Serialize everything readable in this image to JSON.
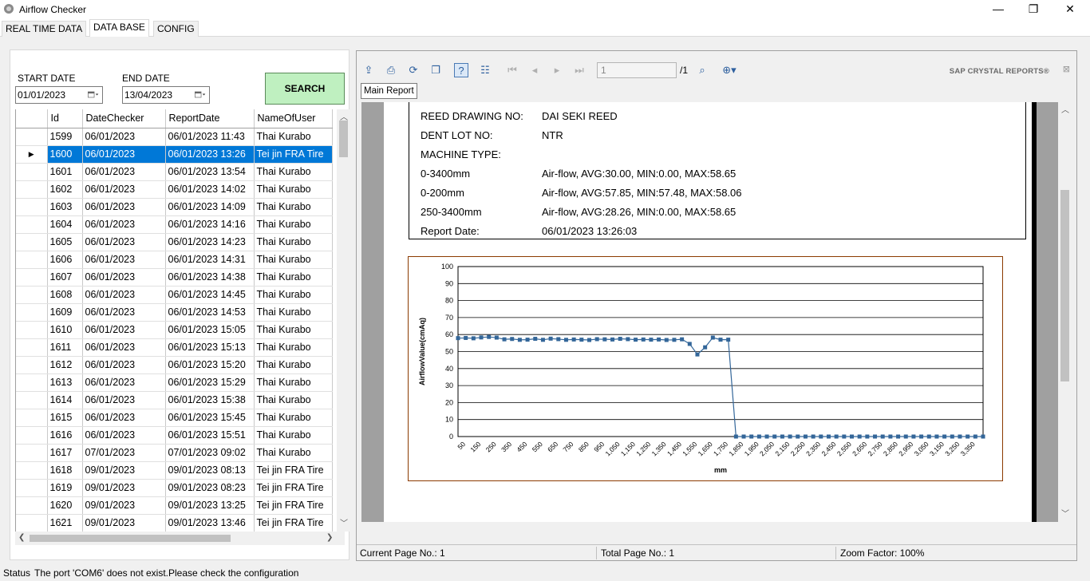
{
  "window": {
    "title": "Airflow Checker",
    "min": "—",
    "max": "❐",
    "close": "✕"
  },
  "tabs": [
    "REAL TIME DATA",
    "DATA BASE",
    "CONFIG"
  ],
  "filter": {
    "start_label": "START DATE",
    "start_value": "01/01/2023",
    "end_label": "END DATE",
    "end_value": "13/04/2023",
    "search_label": "SEARCH"
  },
  "grid": {
    "columns": [
      "Id",
      "DateChecker",
      "ReportDate",
      "NameOfUser"
    ],
    "selected_index": 1,
    "rows": [
      [
        "1599",
        "06/01/2023",
        "06/01/2023 11:43",
        "Thai Kurabo"
      ],
      [
        "1600",
        "06/01/2023",
        "06/01/2023 13:26",
        "Tei jin FRA Tire"
      ],
      [
        "1601",
        "06/01/2023",
        "06/01/2023 13:54",
        "Thai Kurabo"
      ],
      [
        "1602",
        "06/01/2023",
        "06/01/2023 14:02",
        "Thai Kurabo"
      ],
      [
        "1603",
        "06/01/2023",
        "06/01/2023 14:09",
        "Thai Kurabo"
      ],
      [
        "1604",
        "06/01/2023",
        "06/01/2023 14:16",
        "Thai Kurabo"
      ],
      [
        "1605",
        "06/01/2023",
        "06/01/2023 14:23",
        "Thai Kurabo"
      ],
      [
        "1606",
        "06/01/2023",
        "06/01/2023 14:31",
        "Thai Kurabo"
      ],
      [
        "1607",
        "06/01/2023",
        "06/01/2023 14:38",
        "Thai Kurabo"
      ],
      [
        "1608",
        "06/01/2023",
        "06/01/2023 14:45",
        "Thai Kurabo"
      ],
      [
        "1609",
        "06/01/2023",
        "06/01/2023 14:53",
        "Thai Kurabo"
      ],
      [
        "1610",
        "06/01/2023",
        "06/01/2023 15:05",
        "Thai Kurabo"
      ],
      [
        "1611",
        "06/01/2023",
        "06/01/2023 15:13",
        "Thai Kurabo"
      ],
      [
        "1612",
        "06/01/2023",
        "06/01/2023 15:20",
        "Thai Kurabo"
      ],
      [
        "1613",
        "06/01/2023",
        "06/01/2023 15:29",
        "Thai Kurabo"
      ],
      [
        "1614",
        "06/01/2023",
        "06/01/2023 15:38",
        "Thai Kurabo"
      ],
      [
        "1615",
        "06/01/2023",
        "06/01/2023 15:45",
        "Thai Kurabo"
      ],
      [
        "1616",
        "06/01/2023",
        "06/01/2023 15:51",
        "Thai Kurabo"
      ],
      [
        "1617",
        "07/01/2023",
        "07/01/2023 09:02",
        "Thai Kurabo"
      ],
      [
        "1618",
        "09/01/2023",
        "09/01/2023 08:13",
        "Tei jin FRA Tire"
      ],
      [
        "1619",
        "09/01/2023",
        "09/01/2023 08:23",
        "Tei jin FRA Tire"
      ],
      [
        "1620",
        "09/01/2023",
        "09/01/2023 13:25",
        "Tei jin FRA Tire"
      ],
      [
        "1621",
        "09/01/2023",
        "09/01/2023 13:46",
        "Tei jin FRA Tire"
      ]
    ]
  },
  "viewer": {
    "page_input": "1",
    "page_total": "/1",
    "brand": "SAP CRYSTAL REPORTS®",
    "main_tab": "Main Report",
    "status_current": "Current Page No.: 1",
    "status_total": "Total Page No.: 1",
    "status_zoom": "Zoom Factor: 100%"
  },
  "report": {
    "rows": [
      {
        "k": "REED DRAWING NO:",
        "v": "DAI SEKI REED"
      },
      {
        "k": "DENT LOT NO:",
        "v": "NTR"
      },
      {
        "k": "MACHINE TYPE:",
        "v": ""
      },
      {
        "k": "0-3400mm",
        "v": "Air-flow, AVG:30.00, MIN:0.00, MAX:58.65"
      },
      {
        "k": "0-200mm",
        "v": "Air-flow, AVG:57.85, MIN:57.48, MAX:58.06"
      },
      {
        "k": "250-3400mm",
        "v": "Air-flow, AVG:28.26, MIN:0.00, MAX:58.65"
      },
      {
        "k": "Report Date:",
        "v": "06/01/2023  13:26:03"
      }
    ]
  },
  "chart_data": {
    "type": "line",
    "title": "",
    "xlabel": "mm",
    "ylabel": "AirflowValue(cmAq)",
    "ylim": [
      0,
      100
    ],
    "yticks": [
      0,
      10,
      20,
      30,
      40,
      50,
      60,
      70,
      80,
      90,
      100
    ],
    "x_tick_labels": [
      "50",
      "150",
      "250",
      "350",
      "450",
      "550",
      "650",
      "750",
      "850",
      "950",
      "1,050",
      "1,150",
      "1,250",
      "1,350",
      "1,450",
      "1,550",
      "1,650",
      "1,750",
      "1,850",
      "1,950",
      "2,050",
      "2,150",
      "2,250",
      "2,350",
      "2,450",
      "2,550",
      "2,650",
      "2,750",
      "2,850",
      "2,950",
      "3,050",
      "3,150",
      "3,250",
      "3,350"
    ],
    "x": [
      0,
      50,
      100,
      150,
      200,
      250,
      300,
      350,
      400,
      450,
      500,
      550,
      600,
      650,
      700,
      750,
      800,
      850,
      900,
      950,
      1000,
      1050,
      1100,
      1150,
      1200,
      1250,
      1300,
      1350,
      1400,
      1450,
      1500,
      1550,
      1600,
      1650,
      1700,
      1750,
      1800,
      1850,
      1900,
      1950,
      2000,
      2050,
      2100,
      2150,
      2200,
      2250,
      2300,
      2350,
      2400,
      2450,
      2500,
      2550,
      2600,
      2650,
      2700,
      2750,
      2800,
      2850,
      2900,
      2950,
      3000,
      3050,
      3100,
      3150,
      3200,
      3250,
      3300,
      3350,
      3400
    ],
    "grid": true,
    "line_color": "#336699",
    "series": [
      {
        "values": [
          57.9,
          58.0,
          57.8,
          58.3,
          58.6,
          58.2,
          57.2,
          57.4,
          56.9,
          57.0,
          57.5,
          56.9,
          57.6,
          57.3,
          56.9,
          57.1,
          57.0,
          56.8,
          57.3,
          57.2,
          57.1,
          57.5,
          57.3,
          57.0,
          57.1,
          57.0,
          57.1,
          56.8,
          56.9,
          57.2,
          54.5,
          48.3,
          52.5,
          58.2,
          57.0,
          57.0,
          0,
          0,
          0,
          0,
          0,
          0,
          0,
          0,
          0,
          0,
          0,
          0,
          0,
          0,
          0,
          0,
          0,
          0,
          0,
          0,
          0,
          0,
          0,
          0,
          0,
          0,
          0,
          0,
          0,
          0,
          0,
          0,
          0
        ]
      }
    ]
  },
  "app_status": {
    "label": "Status",
    "message": "The port 'COM6' does not exist.Please check the configuration"
  }
}
